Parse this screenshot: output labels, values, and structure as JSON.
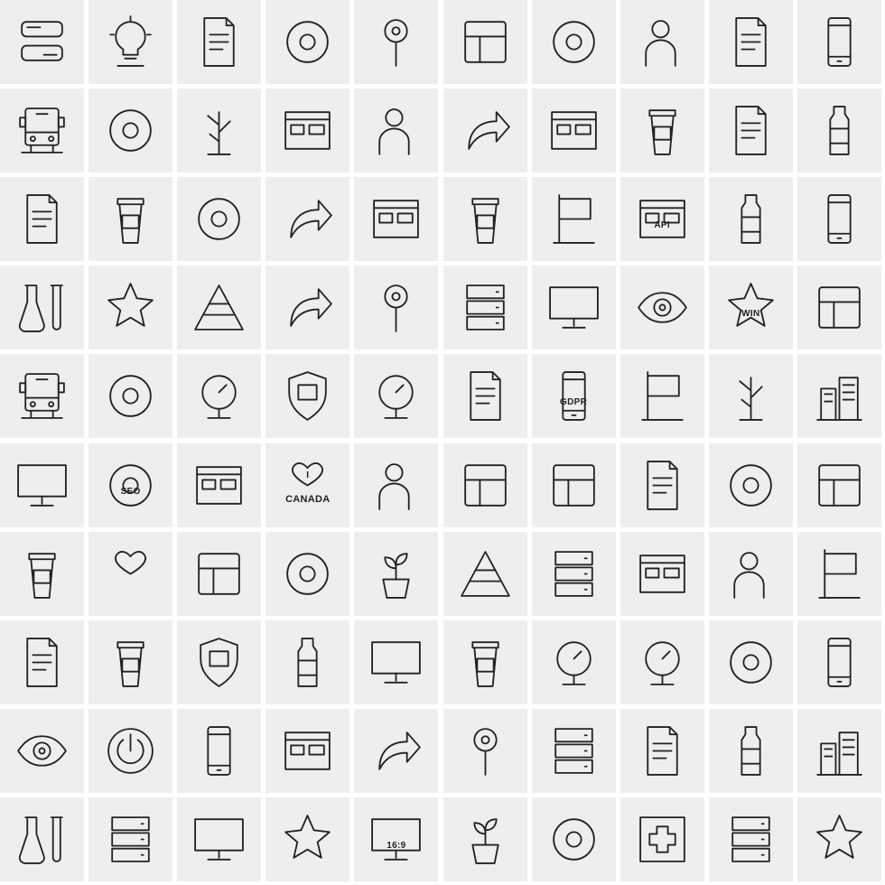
{
  "colors": {
    "cell_background": "#eeeeee",
    "gap": "#ffffff",
    "stroke": "#222222"
  },
  "icons": [
    {
      "name": "chat-bubbles-icon"
    },
    {
      "name": "lightbulb-icon"
    },
    {
      "name": "report-document-icon"
    },
    {
      "name": "spider-web-icon"
    },
    {
      "name": "map-pin-icon"
    },
    {
      "name": "speaker-system-icon"
    },
    {
      "name": "stopwatch-icon"
    },
    {
      "name": "user-clock-icon"
    },
    {
      "name": "resume-documents-icon"
    },
    {
      "name": "mobile-devices-icon"
    },
    {
      "name": "bus-icon"
    },
    {
      "name": "bitcoin-coin-icon"
    },
    {
      "name": "tree-icon"
    },
    {
      "name": "layout-window-icon"
    },
    {
      "name": "users-icon"
    },
    {
      "name": "arrow-up-icon"
    },
    {
      "name": "credit-card-icon"
    },
    {
      "name": "beaker-icon"
    },
    {
      "name": "notebook-pen-icon"
    },
    {
      "name": "cookie-jar-icon"
    },
    {
      "name": "invoice-icon"
    },
    {
      "name": "coffee-cup-icon"
    },
    {
      "name": "cloud-check-icon"
    },
    {
      "name": "phone-call-icon"
    },
    {
      "name": "email-upload-icon"
    },
    {
      "name": "popcorn-icon"
    },
    {
      "name": "christmas-sock-icon"
    },
    {
      "name": "api-window-icon",
      "label": "API"
    },
    {
      "name": "water-bottle-icon"
    },
    {
      "name": "game-console-icon"
    },
    {
      "name": "chemistry-lab-icon"
    },
    {
      "name": "kite-icon"
    },
    {
      "name": "pyramid-icon"
    },
    {
      "name": "share-arrow-icon"
    },
    {
      "name": "plug-check-icon"
    },
    {
      "name": "conveyor-icon"
    },
    {
      "name": "monitor-gauge-icon"
    },
    {
      "name": "eye-icon"
    },
    {
      "name": "win-star-icon",
      "label": "WIN"
    },
    {
      "name": "washing-machine-icon"
    },
    {
      "name": "car-service-icon"
    },
    {
      "name": "rabbit-icon"
    },
    {
      "name": "pressure-gauge-icon"
    },
    {
      "name": "shield-flag-icon"
    },
    {
      "name": "target-stand-icon"
    },
    {
      "name": "star-of-david-book-icon"
    },
    {
      "name": "gdpr-phone-icon",
      "label": "GDPR"
    },
    {
      "name": "flag-icon"
    },
    {
      "name": "wind-turbine-icon"
    },
    {
      "name": "buildings-icon"
    },
    {
      "name": "monitor-speed-icon"
    },
    {
      "name": "seo-tag-icon",
      "label": "SEO"
    },
    {
      "name": "network-folder-icon"
    },
    {
      "name": "i-love-canada-icon",
      "label": "I",
      "label2": "CANADA"
    },
    {
      "name": "head-globe-icon"
    },
    {
      "name": "layout-icon"
    },
    {
      "name": "diamond-chair-icon"
    },
    {
      "name": "file-refresh-icon"
    },
    {
      "name": "duck-icon"
    },
    {
      "name": "sidebar-layout-icon"
    },
    {
      "name": "takeaway-cup-icon"
    },
    {
      "name": "bikini-icon"
    },
    {
      "name": "hands-box-icon"
    },
    {
      "name": "skull-icon"
    },
    {
      "name": "plant-bowl-icon"
    },
    {
      "name": "mountain-flag-icon"
    },
    {
      "name": "newtons-cradle-icon"
    },
    {
      "name": "warning-window-icon"
    },
    {
      "name": "headphones-man-icon"
    },
    {
      "name": "ceiling-lamps-icon"
    },
    {
      "name": "calculator-coins-icon"
    },
    {
      "name": "trophy-icon"
    },
    {
      "name": "shield-icon"
    },
    {
      "name": "fuel-can-icon"
    },
    {
      "name": "laptop-chart-icon"
    },
    {
      "name": "cup-tree-icon"
    },
    {
      "name": "fan-icon"
    },
    {
      "name": "globe-icon"
    },
    {
      "name": "donut-icon"
    },
    {
      "name": "phone-location-icon"
    },
    {
      "name": "eye-drop-icon"
    },
    {
      "name": "power-button-icon"
    },
    {
      "name": "no-phone-icon"
    },
    {
      "name": "money-bill-icon"
    },
    {
      "name": "phone-receiver-icon"
    },
    {
      "name": "joystick-icon"
    },
    {
      "name": "server-rack-icon"
    },
    {
      "name": "prayer-rug-icon"
    },
    {
      "name": "candle-icon"
    },
    {
      "name": "birdhouse-icon"
    },
    {
      "name": "lab-flasks-icon"
    },
    {
      "name": "server-network-icon"
    },
    {
      "name": "monitor-resize-icon"
    },
    {
      "name": "stamp-star-icon"
    },
    {
      "name": "monitor-aspect-icon",
      "label": "16:9"
    },
    {
      "name": "plant-pot-icon"
    },
    {
      "name": "lollipop-search-icon"
    },
    {
      "name": "medical-cross-icon"
    },
    {
      "name": "server-storage-icon"
    },
    {
      "name": "stars-fireworks-icon"
    }
  ]
}
